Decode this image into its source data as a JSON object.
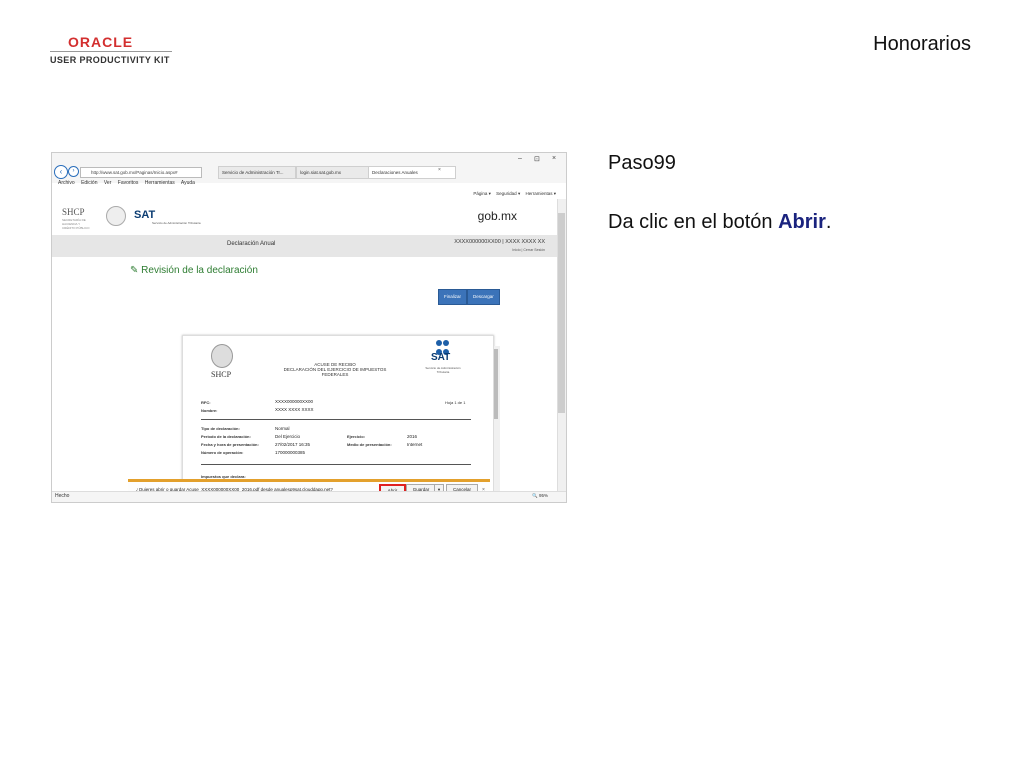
{
  "branding": {
    "oracle": "ORACLE",
    "upk": "USER PRODUCTIVITY KIT"
  },
  "slide": {
    "title": "Honorarios",
    "step": "Paso99",
    "instruction_prefix": "Da clic en el botón ",
    "instruction_target": "Abrir",
    "instruction_suffix": "."
  },
  "browser": {
    "address": "http://www.sat.gob.mx/Paginas/Inicio.aspx#",
    "tabs": [
      "Servicio de Administración Tr...",
      "login.siat.sat.gob.mx",
      "Declaraciones Anuales"
    ],
    "tab_close": "×",
    "window_controls": [
      "–",
      "⊡",
      "×"
    ],
    "menu": [
      "Archivo",
      "Edición",
      "Ver",
      "Favoritos",
      "Herramientas",
      "Ayuda"
    ],
    "command_bar": [
      "Página ▾",
      "Seguridad ▾",
      "Herramientas ▾"
    ],
    "status": "Hecho",
    "zoom": "95%"
  },
  "page": {
    "shcp_logo": "SHCP",
    "shcp_sub": "SECRETARÍA DE HACIENDA Y CRÉDITO PÚBLICO",
    "sat_logo": "SAT",
    "sat_sub": "Servicio de Administración Tributaria",
    "gobmx": "gob.mx",
    "section_title": "Declaración Anual",
    "rfc_header": "XXXX000000XX00 | XXXX XXXX XX",
    "header_links": "Inicio | Cerrar Sesión",
    "revision_title": "Revisión de la declaración",
    "finalizar_label": "Finalizar",
    "descargar_label": "Descargar"
  },
  "document": {
    "acuse_line1": "ACUSE DE RECIBO",
    "acuse_line2": "DECLARACIÓN DEL EJERCICIO DE IMPUESTOS FEDERALES",
    "shcp": "SHCP",
    "sat": "SAT",
    "sat_sub": "Servicio de Administración Tributaria",
    "hoja": "Hoja 1 de 1",
    "rfc_label": "RFC:",
    "rfc_value": "XXXX000000XX00",
    "nombre_label": "Nombre:",
    "nombre_value": "XXXX XXXX XXXX",
    "tipo_label": "Tipo de declaración:",
    "tipo_value": "Normal",
    "periodo_label": "Periodo de la declaración:",
    "periodo_value": "Del Ejercicio",
    "ejercicio_label": "Ejercicio:",
    "ejercicio_value": "2016",
    "fecha_label": "Fecha y hora de presentación:",
    "fecha_value": "27/02/2017 16:35",
    "medio_label": "Medio de presentación:",
    "medio_value": "Internet",
    "operacion_label": "Número de operación:",
    "operacion_value": "170000000385",
    "footer_partial": "Impuestos que declara:"
  },
  "download_bar": {
    "prompt": "¿Quieres abrir o guardar Acuse_XXXX000000XX00_2016.pdf desde anualesp9sat.clouddapp.net?",
    "open_label": "Abrir",
    "save_label": "Guardar",
    "save_menu": "▾",
    "cancel_label": "Cancelar",
    "close_label": "×"
  }
}
